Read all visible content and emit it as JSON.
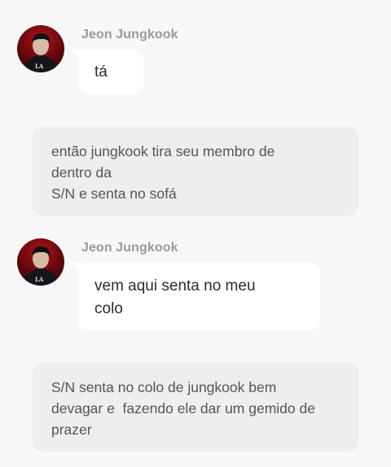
{
  "messages": [
    {
      "sender": "Jeon Jungkook",
      "avatar": "jungkook-avatar",
      "text": "tá"
    },
    {
      "narration_lines": [
        "então jungkook tira seu membro de",
        "dentro da",
        "S/N e senta no sofá"
      ]
    },
    {
      "sender": "Jeon Jungkook",
      "avatar": "jungkook-avatar",
      "text_lines": [
        "vem aqui senta no meu",
        "colo"
      ]
    },
    {
      "narration_lines": [
        "S/N senta no colo de jungkook bem",
        "devagar e  fazendo ele dar um gemido de",
        "prazer"
      ]
    }
  ],
  "colors": {
    "background": "#f7f7f7",
    "bubble": "#ffffff",
    "narration_box": "#eeeeee",
    "sender_name": "#9a9a9a",
    "narration_text": "#555555",
    "message_text": "#2b2b2b"
  }
}
